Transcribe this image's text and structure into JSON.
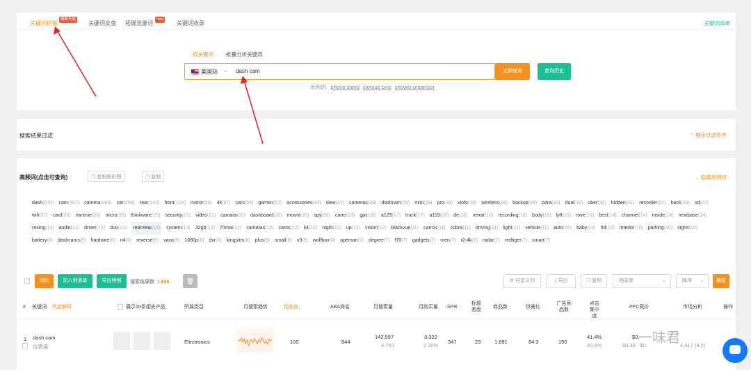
{
  "tabs": [
    {
      "label": "关键词挖掘",
      "badge": "最新升级"
    },
    {
      "label": "关键词反查"
    },
    {
      "label": "拓展流量词",
      "badge": "new"
    },
    {
      "label": "关键词收录"
    }
  ],
  "keyword_list_link": "关键词清单",
  "search": {
    "subtabs": [
      "按关键词",
      "批量分析关键词"
    ],
    "site": "美国站",
    "query": "dash cam",
    "search_button": "立即查询",
    "history_button": "查询历史",
    "examples_label": "示例词:",
    "examples": [
      "phone stand",
      "storage bins",
      "shower organizer"
    ]
  },
  "filter": {
    "title": "搜索结果过滤",
    "show_conditions": "展示过滤条件"
  },
  "high_freq": {
    "title": "高频词(点击可查询)",
    "copy_images": "复制图形图",
    "copy": "复制",
    "hide": "隐藏高频词",
    "words": [
      [
        "dash",
        "570"
      ],
      [
        "cam",
        "487"
      ],
      [
        "camera",
        "380"
      ],
      [
        "car",
        "296"
      ],
      [
        "rear",
        "143"
      ],
      [
        "front",
        "124"
      ],
      [
        "mirror",
        "94"
      ],
      [
        "4k",
        "67"
      ],
      [
        "cars",
        "56"
      ],
      [
        "garmin",
        "52"
      ],
      [
        "accessories",
        "43"
      ],
      [
        "view",
        "43"
      ],
      [
        "cameras",
        "39"
      ],
      [
        "dashcam",
        "39"
      ],
      [
        "mini",
        "39"
      ],
      [
        "pro",
        "39"
      ],
      [
        "viofo",
        "38"
      ],
      [
        "wireless",
        "36"
      ],
      [
        "backup",
        "34"
      ],
      [
        "para",
        "33"
      ],
      [
        "dual",
        "32"
      ],
      [
        "uber",
        "32"
      ],
      [
        "hidden",
        "31"
      ],
      [
        "recorder",
        "31"
      ],
      [
        "back",
        "29"
      ],
      [
        "sd",
        "27"
      ],
      [
        "wifi",
        "27"
      ],
      [
        "card",
        "26"
      ],
      [
        "vantrue",
        "26"
      ],
      [
        "micro",
        "25"
      ],
      [
        "thinkware",
        "25"
      ],
      [
        "security",
        "21"
      ],
      [
        "video",
        "21"
      ],
      [
        "camara",
        "20"
      ],
      [
        "dashboard",
        "20"
      ],
      [
        "mount",
        "20"
      ],
      [
        "spy",
        "20"
      ],
      [
        "carro",
        "19"
      ],
      [
        "gps",
        "18"
      ],
      [
        "a129",
        "17"
      ],
      [
        "truck",
        "17"
      ],
      [
        "a119",
        "16"
      ],
      [
        "de",
        "16"
      ],
      [
        "nexar",
        "16"
      ],
      [
        "recording",
        "16"
      ],
      [
        "body",
        "15"
      ],
      [
        "lyft",
        "15"
      ],
      [
        "rove",
        "15"
      ],
      [
        "best",
        "14"
      ],
      [
        "channel",
        "14"
      ],
      [
        "inside",
        "14"
      ],
      [
        "nextbase",
        "14"
      ],
      [
        "rexing",
        "14"
      ],
      [
        "audio",
        "13"
      ],
      [
        "driver",
        "13"
      ],
      [
        "duo",
        "13"
      ],
      [
        "rearview",
        "13"
      ],
      [
        "system",
        "13"
      ],
      [
        "32gb",
        "12"
      ],
      [
        "70mai",
        "12"
      ],
      [
        "camaras",
        "12"
      ],
      [
        "cams",
        "12"
      ],
      [
        "kit",
        "12"
      ],
      [
        "night",
        "12"
      ],
      [
        "up",
        "12"
      ],
      [
        "vision",
        "12"
      ],
      [
        "blackvue",
        "11"
      ],
      [
        "carros",
        "11"
      ],
      [
        "cobra",
        "11"
      ],
      [
        "driving",
        "11"
      ],
      [
        "light",
        "11"
      ],
      [
        "vehicle",
        "11"
      ],
      [
        "auto",
        "10"
      ],
      [
        "baby",
        "10"
      ],
      [
        "hd",
        "10"
      ],
      [
        "interior",
        "10"
      ],
      [
        "parking",
        "10"
      ],
      [
        "signs",
        "10"
      ],
      [
        "battery",
        "9"
      ],
      [
        "dashcams",
        "9"
      ],
      [
        "hardwire",
        "9"
      ],
      [
        "n4",
        "9"
      ],
      [
        "reverse",
        "9"
      ],
      [
        "vava",
        "9"
      ],
      [
        "1080p",
        "8"
      ],
      [
        "dvr",
        "8"
      ],
      [
        "kingslim",
        "8"
      ],
      [
        "plus",
        "8"
      ],
      [
        "small",
        "8"
      ],
      [
        "v3",
        "8"
      ],
      [
        "wolfbox",
        "8"
      ],
      [
        "apeman",
        "7"
      ],
      [
        "degree",
        "7"
      ],
      [
        "f70",
        "7"
      ],
      [
        "gadgets",
        "7"
      ],
      [
        "men",
        "7"
      ],
      [
        "r2-4k",
        "7"
      ],
      [
        "radar",
        "7"
      ],
      [
        "redtiger",
        "7"
      ],
      [
        "smart",
        "7"
      ]
    ],
    "highlighted": [
      "rearview"
    ]
  },
  "table_toolbar": {
    "compare": "对比",
    "add_to_list": "加入到清单",
    "export_detail": "导出明细",
    "result_count_label": "搜索结果数:",
    "result_count": "1,626",
    "custom_columns": "自定义列",
    "export": "导出",
    "copy": "复制",
    "sort_field": "相关度",
    "sort_order": "降序",
    "confirm": "确定"
  },
  "table": {
    "headers": [
      "#",
      "关键词",
      "热度解释",
      "展示10条相关产品",
      "所属类目",
      "月搜索趋势",
      "相关度",
      "ABA排名",
      "月搜索量",
      "月购买量",
      "SPR",
      "标题密度",
      "商品数",
      "供需比",
      "广告竞品数",
      "点击集中度",
      "PPC竞价",
      "市场分析",
      "操作"
    ],
    "rows": [
      {
        "index": "1",
        "keyword": "dash cam",
        "keyword_cn": "仪表盘",
        "category": "Electronics",
        "relevance": "100",
        "aba_rank": "844",
        "monthly_search": "142,597",
        "monthly_search_sub": "4,753",
        "monthly_purchase": "3,322",
        "purchase_rate": "2.30%",
        "spr": "347",
        "title_density": "23",
        "product_count": "1,691",
        "supply_demand": "84.3",
        "ad_competitors": "190",
        "click_conc": "41.4%",
        "click_conc_sub": "40.4%",
        "ppc": "$0.",
        "ppc_range": "$0.38 - $0.",
        "market": "4,917 (4.5)"
      }
    ]
  },
  "watermark": "一味君",
  "trend": [
    0.55,
    0.5,
    0.62,
    0.45,
    0.58,
    0.4,
    0.52,
    0.3,
    0.48,
    0.55,
    0.42,
    0.6,
    0.5,
    0.38,
    0.56,
    0.45,
    0.62,
    0.52,
    0.4,
    0.5,
    0.35,
    0.58,
    0.48,
    0.55
  ]
}
